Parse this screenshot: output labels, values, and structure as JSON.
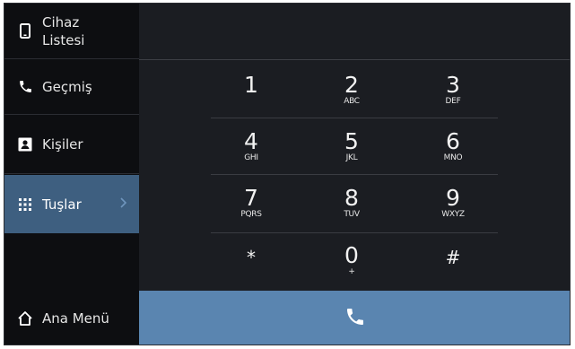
{
  "sidebar": {
    "device_list_line1": "Cihaz",
    "device_list_line2": "Listesi",
    "history": "Geçmiş",
    "contacts": "Kişiler",
    "keypad": "Tuşlar",
    "home": "Ana Menü"
  },
  "keys": [
    {
      "num": "1",
      "letters": ""
    },
    {
      "num": "2",
      "letters": "ABC"
    },
    {
      "num": "3",
      "letters": "DEF"
    },
    {
      "num": "4",
      "letters": "GHI"
    },
    {
      "num": "5",
      "letters": "JKL"
    },
    {
      "num": "6",
      "letters": "MNO"
    },
    {
      "num": "7",
      "letters": "PQRS"
    },
    {
      "num": "8",
      "letters": "TUV"
    },
    {
      "num": "9",
      "letters": "WXYZ"
    },
    {
      "num": "*",
      "letters": ""
    },
    {
      "num": "0",
      "letters": "+"
    },
    {
      "num": "#",
      "letters": ""
    }
  ],
  "icons": {
    "device": "phone-device-icon",
    "history": "phone-handset-icon",
    "contacts": "contact-card-icon",
    "keypad": "dialpad-grid-icon",
    "home": "home-icon",
    "call": "call-icon",
    "chevron": "chevron-right-icon"
  },
  "colors": {
    "active_tab": "#3e5f80",
    "call_button": "#5a85b0",
    "background": "#1b1d22",
    "sidebar": "#0d0e11"
  }
}
